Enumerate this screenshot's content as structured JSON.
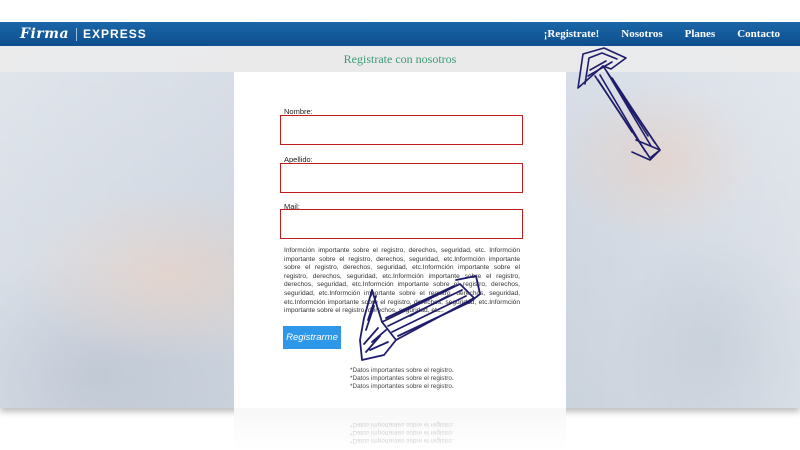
{
  "header": {
    "logo_script": "Firma",
    "logo_text": "EXPRESS",
    "brand_color": "#0f4f8d",
    "nav": [
      {
        "label": "¡Registrate!"
      },
      {
        "label": "Nosotros"
      },
      {
        "label": "Planes"
      },
      {
        "label": "Contacto"
      }
    ]
  },
  "page": {
    "title": "Registrate con nosotros",
    "title_color": "#3a9a75"
  },
  "form": {
    "fields": [
      {
        "label": "Nombre:",
        "value": "",
        "placeholder": ""
      },
      {
        "label": "Apellido:",
        "value": "",
        "placeholder": ""
      },
      {
        "label": "Mail:",
        "value": "",
        "placeholder": ""
      }
    ],
    "field_border_color": "#c41c1c",
    "info_text": "Informción importante sobre el registro, derechos, seguridad, etc. Informción importante sobre el registro, derechos, seguridad, etc.Informción importante sobre el registro, derechos, seguridad, etc.Informción importante sobre el registro, derechos, seguridad, etc.Informción importante sobre el registro, derechos, seguridad, etc.Informción importante sobre el registro, derechos, seguridad, etc.Informción importante sobre el registro, derechos, seguridad, etc.Informción importante sobre el registro, derechos, seguridad, etc.Informción importante sobre el registro, derechos, seguridad, etc..",
    "submit_label": "Registrarme",
    "submit_color": "#2f97e8",
    "notes": [
      "*Datos importantes sobre el registro.",
      "*Datos importantes sobre el registro.",
      "*Datos importantes sobre el registro."
    ]
  },
  "annotations": {
    "arrow_color": "#1f1d6b"
  }
}
